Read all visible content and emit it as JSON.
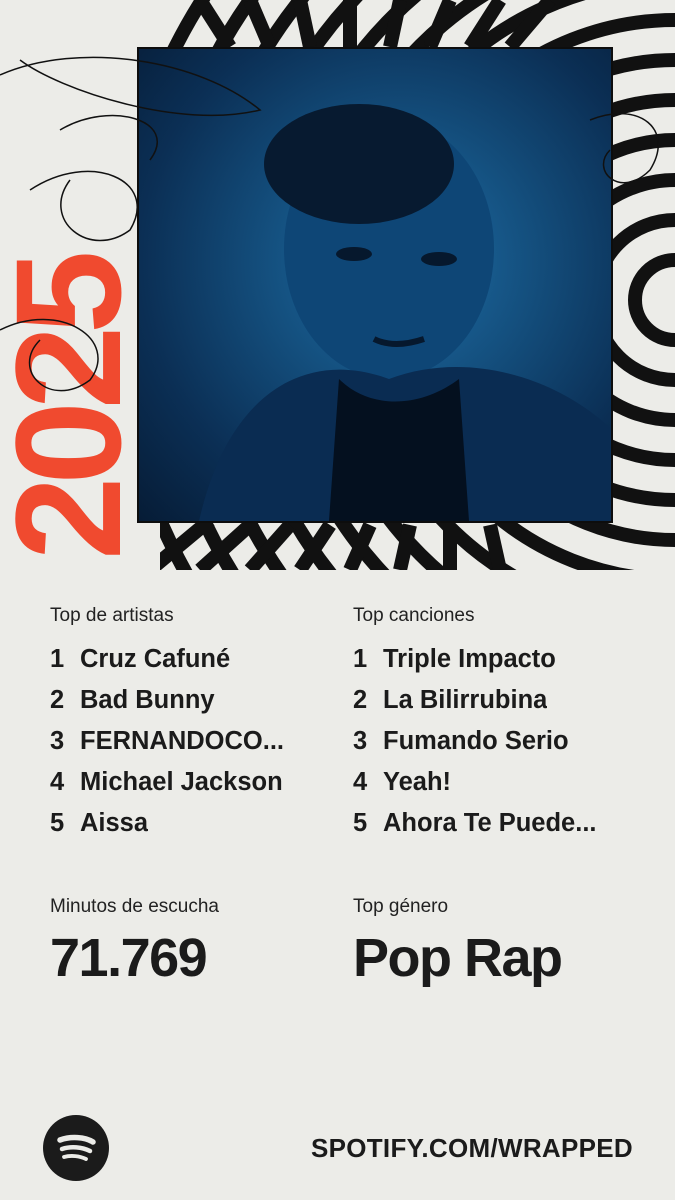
{
  "hero": {
    "year": "2025",
    "photo_alt": "Cruz Cafuné"
  },
  "top_artists": {
    "label": "Top de artistas",
    "items": [
      {
        "rank": "1",
        "name": "Cruz Cafuné"
      },
      {
        "rank": "2",
        "name": "Bad Bunny"
      },
      {
        "rank": "3",
        "name": "FERNANDOCO..."
      },
      {
        "rank": "4",
        "name": "Michael Jackson"
      },
      {
        "rank": "5",
        "name": "Aissa"
      }
    ]
  },
  "top_songs": {
    "label": "Top canciones",
    "items": [
      {
        "rank": "1",
        "name": "Triple Impacto"
      },
      {
        "rank": "2",
        "name": "La Bilirrubina"
      },
      {
        "rank": "3",
        "name": "Fumando Serio"
      },
      {
        "rank": "4",
        "name": "Yeah!"
      },
      {
        "rank": "5",
        "name": "Ahora Te Puede..."
      }
    ]
  },
  "minutes": {
    "label": "Minutos de escucha",
    "value": "71.769"
  },
  "genre": {
    "label": "Top género",
    "value": "Pop Rap"
  },
  "footer": {
    "logo_icon": "spotify-logo-icon",
    "url": "SPOTIFY.COM/WRAPPED"
  },
  "colors": {
    "background": "#ecece8",
    "accent_red": "#f04a2f",
    "text": "#1b1b1b",
    "photo_blue": "#14507f"
  }
}
